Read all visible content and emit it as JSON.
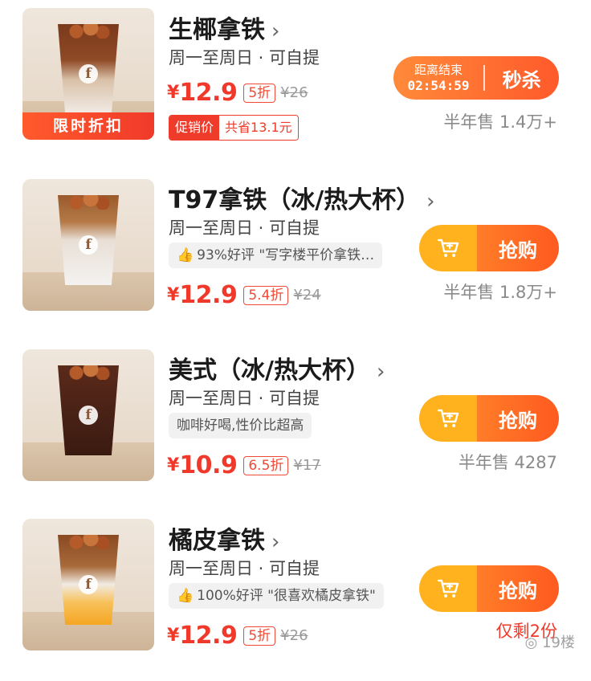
{
  "products": [
    {
      "name": "生椰拿铁",
      "availability": "周一至周日 · 可自提",
      "ribbon": "限时折扣",
      "price_symbol": "¥",
      "price": "12.9",
      "discount": "5折",
      "original_price": "¥26",
      "promo_tag": "促销价",
      "promo_saving": "共省13.1元",
      "countdown_label": "距离结束",
      "countdown_time": "02:54:59",
      "action": "秒杀",
      "sales": "半年售 1.4万+",
      "liquid_top": "#7a3a1c",
      "liquid_bottom": "#f2ece6"
    },
    {
      "name": "T97拿铁（冰/热大杯）",
      "availability": "周一至周日 · 可自提",
      "review": "93%好评 \"写字楼平价拿铁…",
      "price_symbol": "¥",
      "price": "12.9",
      "discount": "5.4折",
      "original_price": "¥24",
      "action": "抢购",
      "sales": "半年售 1.8万+",
      "liquid_top": "#9a5a2c",
      "liquid_bottom": "#f4f2f0"
    },
    {
      "name": "美式（冰/热大杯）",
      "availability": "周一至周日 · 可自提",
      "review": "咖啡好喝,性价比超高",
      "price_symbol": "¥",
      "price": "10.9",
      "discount": "6.5折",
      "original_price": "¥17",
      "action": "抢购",
      "sales": "半年售 4287",
      "liquid_top": "#5a2a1a",
      "liquid_bottom": "#3a1a10"
    },
    {
      "name": "橘皮拿铁",
      "availability": "周一至周日 · 可自提",
      "review": "100%好评 \"很喜欢橘皮拿铁\"",
      "price_symbol": "¥",
      "price": "12.9",
      "discount": "5折",
      "original_price": "¥26",
      "action": "抢购",
      "sales": "仅剩2份",
      "liquid_top": "#8a4a22",
      "liquid_bottom": "#f5a623"
    }
  ],
  "watermark": "19楼",
  "colors": {
    "accent_red": "#f0392a",
    "accent_orange": "#ff5a20",
    "cart_yellow": "#ffb21e"
  },
  "icons": {
    "chevron": "chevron-right-icon",
    "thumb": "thumbs-up-icon",
    "cart": "cart-plus-icon"
  }
}
